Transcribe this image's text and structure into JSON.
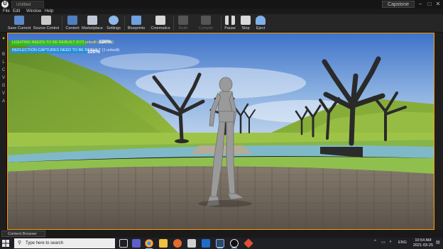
{
  "window": {
    "tab_title": "Untitled",
    "project_name": "Capstone",
    "minimize": "–",
    "maximize": "□",
    "close": "✕"
  },
  "menu": [
    "File",
    "Edit",
    "Window",
    "Help"
  ],
  "toolbar": [
    {
      "label": "Save Current",
      "icon": "save-icon",
      "color": "#5a88c8"
    },
    {
      "label": "Source Control",
      "icon": "source-control-icon",
      "color": "#c9c9c9"
    },
    {
      "label": "Content",
      "icon": "content-icon",
      "color": "#4f7fc0"
    },
    {
      "label": "Marketplace",
      "icon": "marketplace-icon",
      "color": "#c0c8d8"
    },
    {
      "label": "Settings",
      "icon": "settings-icon",
      "color": "#8fb8e8"
    },
    {
      "label": "Blueprints",
      "icon": "blueprints-icon",
      "color": "#6fa0e0"
    },
    {
      "label": "Cinematics",
      "icon": "cinematics-icon",
      "color": "#d8d8d8"
    },
    {
      "label": "Build",
      "icon": "build-icon",
      "color": "#555555"
    },
    {
      "label": "Compile",
      "icon": "compile-icon",
      "color": "#555555"
    },
    {
      "label": "Pause",
      "icon": "pause-icon",
      "color": "#d8d8d8"
    },
    {
      "label": "Stop",
      "icon": "stop-icon",
      "color": "#d8d8d8"
    },
    {
      "label": "Eject",
      "icon": "eject-icon",
      "color": "#7fb0e8"
    }
  ],
  "left_dock": [
    "B",
    "L",
    "C",
    "V",
    "G",
    "V",
    "A"
  ],
  "viewport": {
    "lighting_message": "LIGHTING NEEDS TO BE REBUILT (573 unbuilt object(s))",
    "lighting_percent": "100%",
    "reflection_message": "REFLECTION CAPTURES NEED TO BE REBUILT (1 unbuilt)",
    "reflection_percent": "100%"
  },
  "content_browser": {
    "label": "Content Browser"
  },
  "taskbar": {
    "search_placeholder": "Type here to search",
    "apps": [
      {
        "name": "task-view-icon",
        "color": "#d8d8d8"
      },
      {
        "name": "teams-icon",
        "color": "#5b5fc7"
      },
      {
        "name": "chrome-icon",
        "color": "#e8b43a"
      },
      {
        "name": "file-explorer-icon",
        "color": "#f0c040"
      },
      {
        "name": "firefox-icon",
        "color": "#e86a2a"
      },
      {
        "name": "photos-icon",
        "color": "#d0d0d0"
      },
      {
        "name": "outlook-icon",
        "color": "#1e6ec8"
      },
      {
        "name": "steam-icon",
        "color": "#2a4a6a"
      },
      {
        "name": "unreal-taskbar-icon",
        "color": "#e8e8e8"
      },
      {
        "name": "git-icon",
        "color": "#e05030"
      }
    ],
    "language": "ENG",
    "time": "10:54 AM",
    "date": "2021-03-25"
  }
}
